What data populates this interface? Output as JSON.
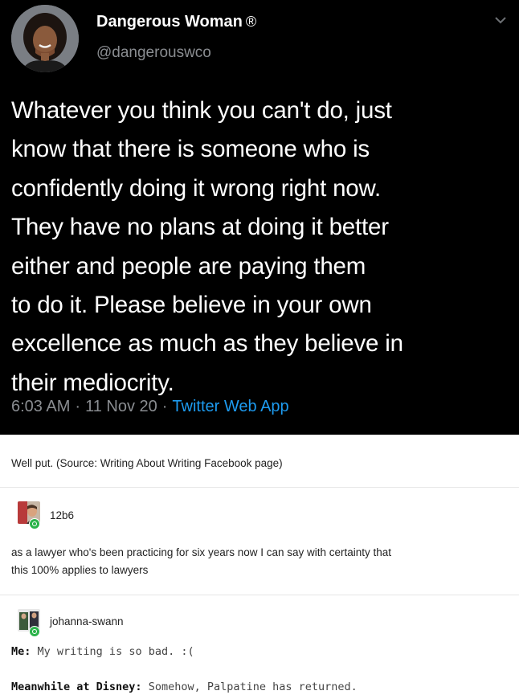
{
  "tweet": {
    "display_name": "Dangerous Woman",
    "verified_mark": "®",
    "handle": "@dangerouswco",
    "text_lines": [
      "Whatever you think you can't do, just",
      "know that there is someone who is",
      "confidently doing it wrong right now.",
      "They have no plans at doing it better",
      "either and people are paying them",
      "to do it. Please believe in your own",
      "excellence as much as they believe in",
      "their mediocrity."
    ],
    "time": "6:03 AM",
    "separator": "·",
    "date": "11 Nov 20",
    "app": "Twitter Web App",
    "icons": {
      "menu": "chevron-down-icon"
    },
    "colors": {
      "background": "#000000",
      "text": "#ffffff",
      "muted": "#8a8d91",
      "link": "#1d9bf0"
    }
  },
  "post": {
    "caption": "Well put. (Source: Writing About Writing Facebook page)"
  },
  "reblogs": [
    {
      "username": "12b6",
      "text_lines": [
        "as a lawyer who's been practicing for six years now I can say with certainty that",
        "this 100% applies to lawyers"
      ]
    },
    {
      "username": "johanna-swann",
      "lines": [
        {
          "speaker": "Me:",
          "text": "My writing is so bad. :("
        },
        {
          "speaker": "Meanwhile at Disney:",
          "text": "Somehow, Palpatine has returned."
        }
      ]
    }
  ],
  "colors": {
    "follow_badge": "#2bb34a"
  }
}
